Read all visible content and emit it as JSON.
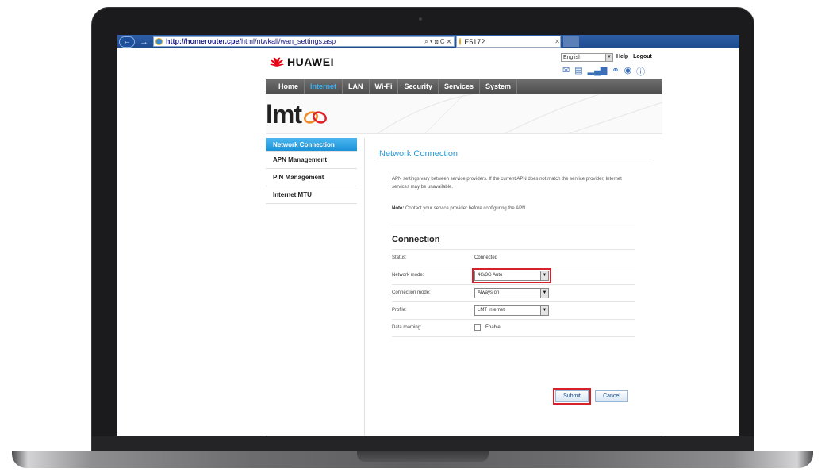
{
  "browser": {
    "url_host": "http://homerouter.cpe",
    "url_path": "/html/ntwkall/wan_settings.asp",
    "url_tools": "⌕ ▾ ⊠ C ✕",
    "tab_title": "E5172"
  },
  "router": {
    "brand": "HUAWEI",
    "language": "English",
    "help_label": "Help",
    "logout_label": "Logout",
    "operator_logo": "lmt"
  },
  "nav": {
    "items": [
      {
        "label": "Home"
      },
      {
        "label": "Internet",
        "active": true
      },
      {
        "label": "LAN"
      },
      {
        "label": "Wi-Fi"
      },
      {
        "label": "Security"
      },
      {
        "label": "Services"
      },
      {
        "label": "System"
      }
    ]
  },
  "sidebar": {
    "items": [
      {
        "label": "Network Connection",
        "active": true
      },
      {
        "label": "APN Management"
      },
      {
        "label": "PIN Management"
      },
      {
        "label": "Internet MTU"
      }
    ]
  },
  "content": {
    "title": "Network Connection",
    "description": "APN settings vary between service providers. If the current APN does not match the service provider, Internet services may be unavailable.",
    "note_label": "Note:",
    "note_text": "Contact your service provider before configuring the APN.",
    "section_title": "Connection",
    "status_label": "Status:",
    "status_value": "Connected",
    "network_mode_label": "Network mode:",
    "network_mode_value": "4G/3G Auto",
    "connection_mode_label": "Connection mode:",
    "connection_mode_value": "Always on",
    "profile_label": "Profile:",
    "profile_value": "LMT Internet",
    "roaming_label": "Data roaming:",
    "roaming_option": "Enable",
    "roaming_enabled": false,
    "submit_label": "Submit",
    "cancel_label": "Cancel"
  },
  "colors": {
    "accent_blue": "#2a9ad8",
    "nav_bar": "#555555",
    "highlight_red": "#d8202a",
    "huawei_red": "#e60012"
  }
}
